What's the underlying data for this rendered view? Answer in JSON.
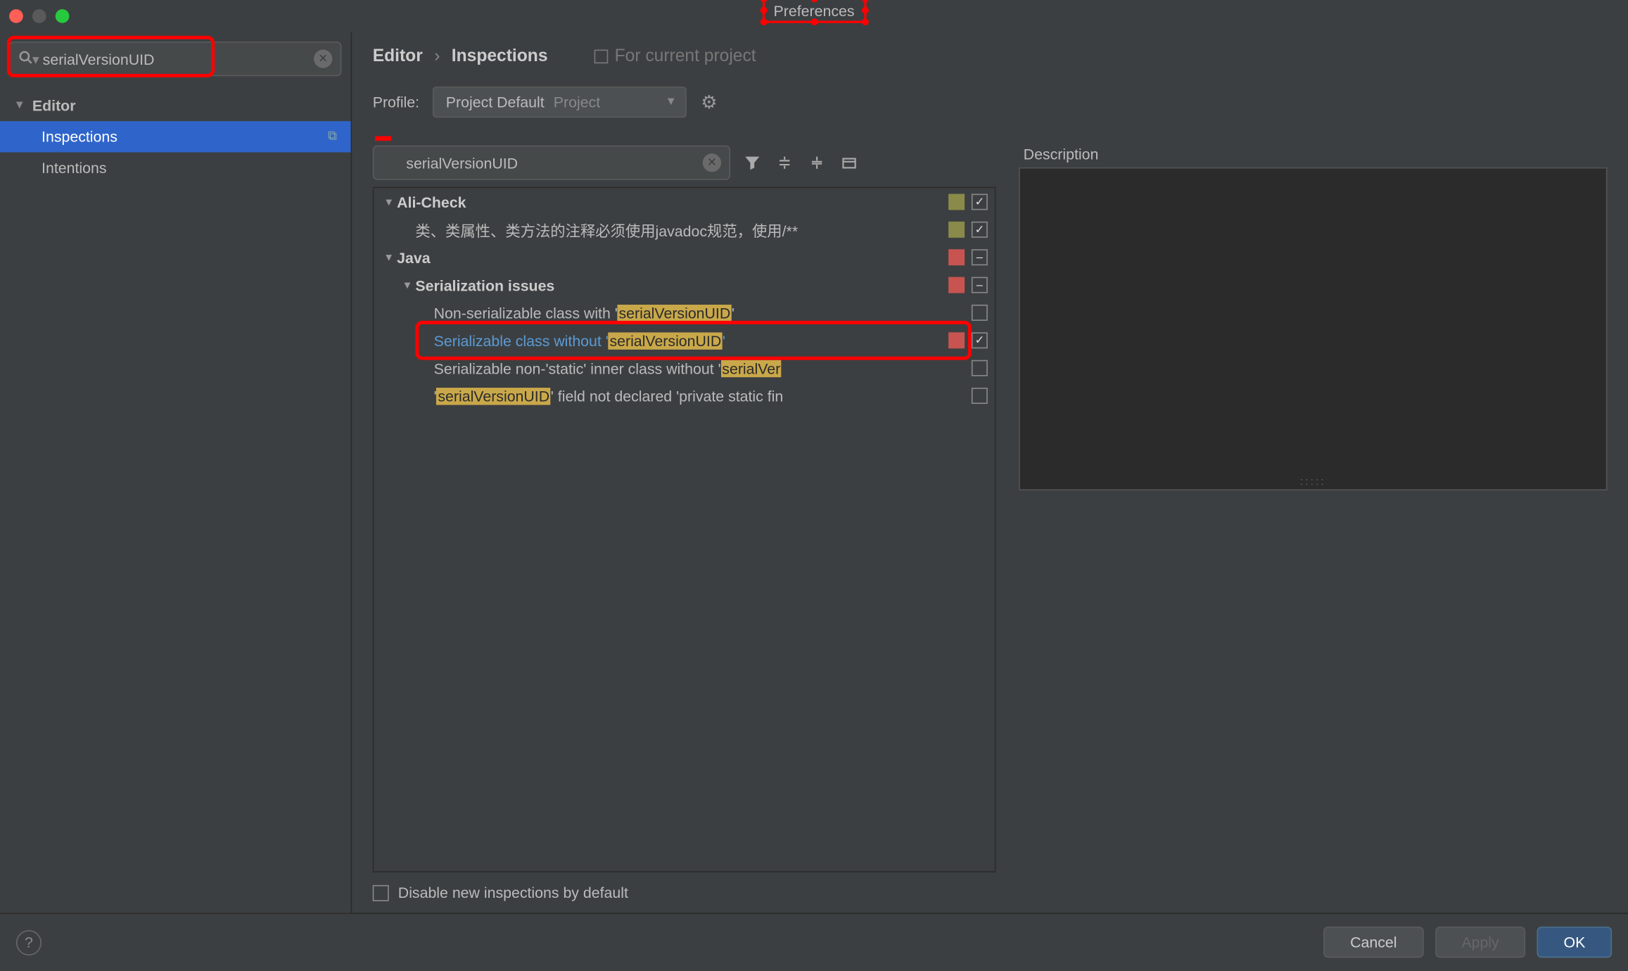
{
  "window": {
    "title": "Preferences"
  },
  "sidebar": {
    "search_value": "serialVersionUID",
    "root": {
      "label": "Editor"
    },
    "items": [
      {
        "label": "Inspections",
        "selected": true
      },
      {
        "label": "Intentions",
        "selected": false
      }
    ]
  },
  "breadcrumb": {
    "a": "Editor",
    "b": "Inspections",
    "scope": "For current project"
  },
  "profile": {
    "label": "Profile:",
    "value": "Project Default",
    "suffix": "Project"
  },
  "inspection_search_value": "serialVersionUID",
  "tree": {
    "g1": {
      "label": "Ali-Check"
    },
    "g1_i1": {
      "label": "类、类属性、类方法的注释必须使用javadoc规范，使用/**"
    },
    "g2": {
      "label": "Java"
    },
    "g2_s1": {
      "label": "Serialization issues"
    },
    "g2_s1_i1_pre": "Non-serializable class with '",
    "g2_s1_i1_hl": "serialVersionUID",
    "g2_s1_i1_post": "'",
    "g2_s1_i2_pre": "Serializable class without '",
    "g2_s1_i2_hl": "serialVersionUID",
    "g2_s1_i2_post": "'",
    "g2_s1_i3_pre": "Serializable non-'static' inner class without '",
    "g2_s1_i3_hl": "serialVer",
    "g2_s1_i4_pre": "'",
    "g2_s1_i4_hl": "serialVersionUID",
    "g2_s1_i4_post": "' field not declared 'private static fin"
  },
  "description_label": "Description",
  "disable_label": "Disable new inspections by default",
  "footer": {
    "cancel": "Cancel",
    "apply": "Apply",
    "ok": "OK"
  }
}
